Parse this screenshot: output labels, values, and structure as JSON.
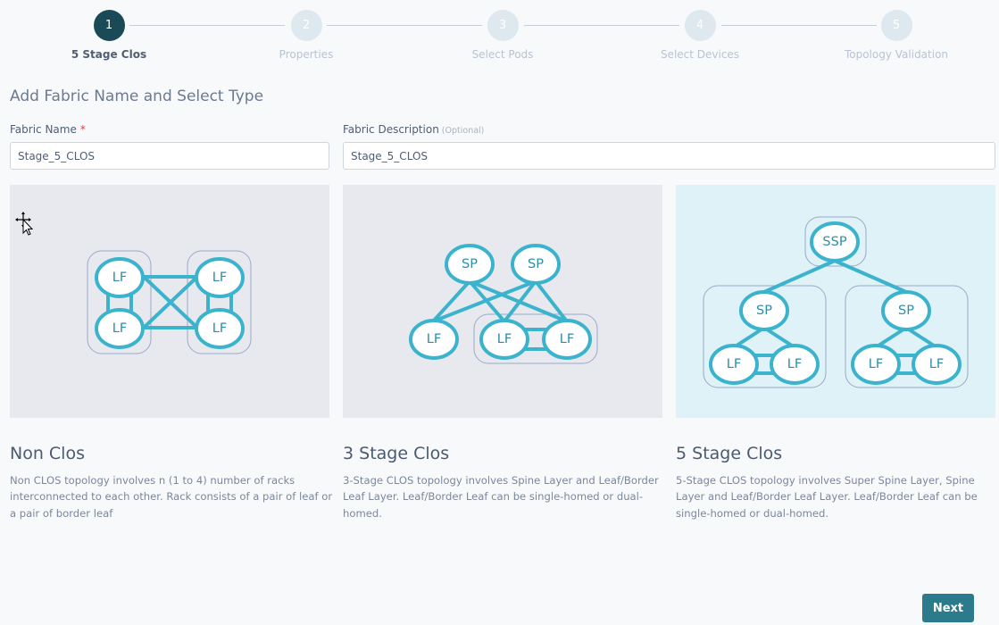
{
  "stepper": {
    "steps": [
      {
        "number": "1",
        "label": "5 Stage Clos",
        "active": true
      },
      {
        "number": "2",
        "label": "Properties",
        "active": false
      },
      {
        "number": "3",
        "label": "Select Pods",
        "active": false
      },
      {
        "number": "4",
        "label": "Select Devices",
        "active": false
      },
      {
        "number": "5",
        "label": "Topology Validation",
        "active": false
      }
    ]
  },
  "form": {
    "section_title": "Add Fabric Name and Select Type",
    "fabric_name": {
      "label": "Fabric Name",
      "required_mark": "*",
      "value": "Stage_5_CLOS"
    },
    "fabric_description": {
      "label": "Fabric Description",
      "optional_note": "(Optional)",
      "value": "Stage_5_CLOS"
    }
  },
  "topology_cards": [
    {
      "id": "non-clos",
      "title": "Non Clos",
      "description": "Non CLOS topology involves n (1 to 4) number of racks interconnected to each other. Rack consists of a pair of leaf or a pair of border leaf",
      "selected": false,
      "node_labels": {
        "leaf": "LF"
      }
    },
    {
      "id": "3-stage-clos",
      "title": "3 Stage Clos",
      "description": "3-Stage CLOS topology involves Spine Layer and Leaf/Border Leaf Layer. Leaf/Border Leaf can be single-homed or dual-homed.",
      "selected": false,
      "node_labels": {
        "spine": "SP",
        "leaf": "LF"
      }
    },
    {
      "id": "5-stage-clos",
      "title": "5 Stage Clos",
      "description": "5-Stage CLOS topology involves Super Spine Layer, Spine Layer and Leaf/Border Leaf Layer. Leaf/Border Leaf can be single-homed or dual-homed.",
      "selected": true,
      "node_labels": {
        "super_spine": "SSP",
        "spine": "SP",
        "leaf": "LF"
      }
    }
  ],
  "actions": {
    "next_label": "Next"
  },
  "colors": {
    "active_step": "#1b4a57",
    "inactive_step": "#dde9ef",
    "accent_button": "#2c7b8c",
    "node_stroke": "#3cb3cd",
    "selected_card_bg": "#def2f7",
    "required_mark": "#e0393e"
  }
}
